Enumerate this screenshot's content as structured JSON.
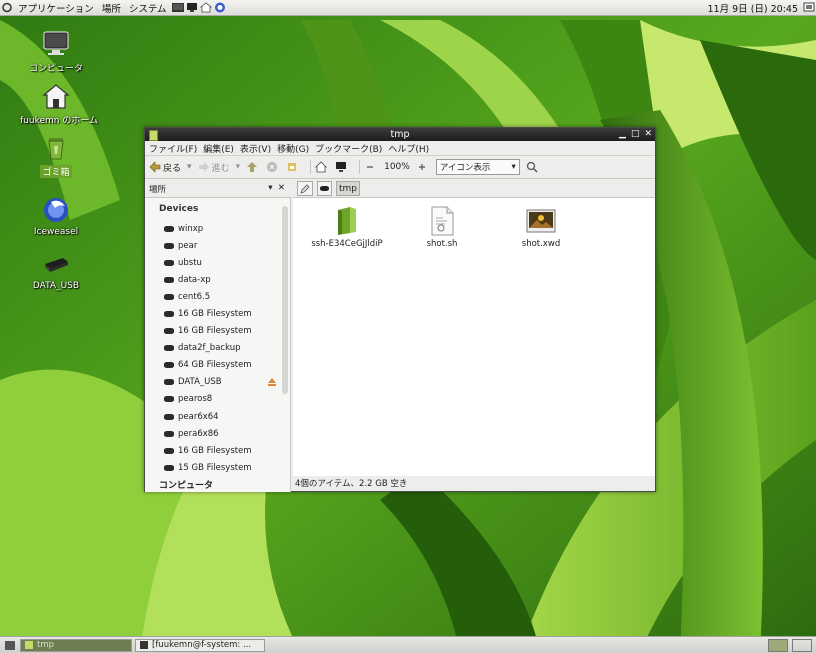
{
  "top_panel": {
    "menus": [
      "アプリケーション",
      "場所",
      "システム"
    ],
    "clock": "11月 9日 (日) 20:45"
  },
  "desktop_icons": [
    {
      "label": "コンピュータ",
      "icon": "computer-icon"
    },
    {
      "label": "fuukemn のホーム",
      "icon": "home-folder-icon"
    },
    {
      "label": "ゴミ箱",
      "icon": "trash-icon",
      "selected": true
    },
    {
      "label": "Iceweasel",
      "icon": "iceweasel-icon"
    },
    {
      "label": "DATA_USB",
      "icon": "usb-drive-icon"
    }
  ],
  "window": {
    "title": "tmp",
    "menubar": [
      "ファイル(F)",
      "編集(E)",
      "表示(V)",
      "移動(G)",
      "ブックマーク(B)",
      "ヘルプ(H)"
    ],
    "toolbar": {
      "back": "戻る",
      "forward": "進む",
      "zoom": "100%",
      "view_mode": "アイコン表示"
    },
    "sidebar": {
      "header": "場所",
      "section_devices": "Devices",
      "devices": [
        "winxp",
        "pear",
        "ubstu",
        "data-xp",
        "cent6.5",
        "16 GB Filesystem",
        "16 GB Filesystem",
        "data2f_backup",
        "64 GB Filesystem",
        "DATA_USB",
        "pearos8",
        "pear6x64",
        "pera6x86",
        "16 GB Filesystem",
        "15 GB Filesystem"
      ],
      "section_computer": "コンピュータ"
    },
    "pathbar": {
      "current": "tmp"
    },
    "files": [
      {
        "name": "ssh-E34CeGjJldiP",
        "icon": "folder-icon"
      },
      {
        "name": "shot.sh",
        "icon": "script-file-icon"
      },
      {
        "name": "shot.xwd",
        "icon": "image-file-icon"
      }
    ],
    "status": "4個のアイテム、2.2 GB 空き"
  },
  "taskbar": {
    "tasks": [
      "tmp",
      "[fuukemn@f-system: ..."
    ]
  }
}
